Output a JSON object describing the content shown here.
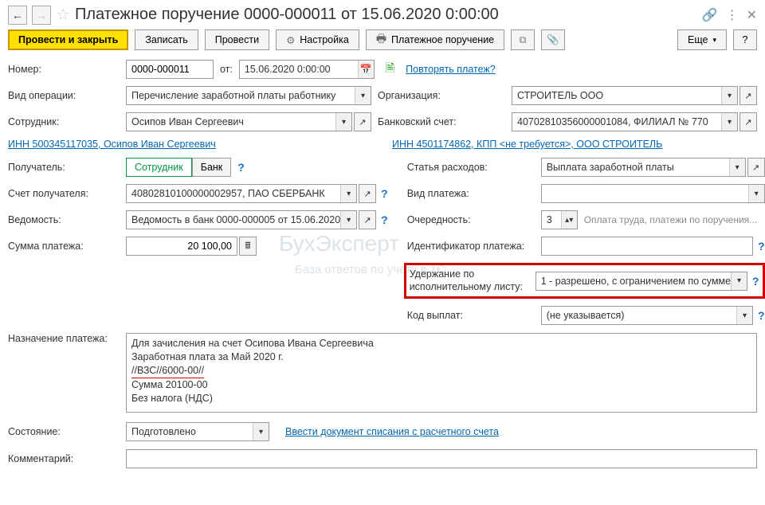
{
  "title": "Платежное поручение 0000-000011 от 15.06.2020 0:00:00",
  "toolbar": {
    "post_close": "Провести и закрыть",
    "save": "Записать",
    "post": "Провести",
    "settings": "Настройка",
    "print_doc": "Платежное поручение",
    "more": "Еще",
    "help": "?"
  },
  "fields": {
    "number_label": "Номер:",
    "number": "0000-000011",
    "from_label": "от:",
    "date": "15.06.2020  0:00:00",
    "repeat_link": "Повторять платеж?",
    "op_type_label": "Вид операции:",
    "op_type": "Перечисление заработной платы работнику",
    "org_label": "Организация:",
    "org": "СТРОИТЕЛЬ ООО",
    "employee_label": "Сотрудник:",
    "employee": "Осипов Иван Сергеевич",
    "bank_acc_label": "Банковский счет:",
    "bank_acc": "40702810356000001084, ФИЛИАЛ № 770",
    "inn_left": "ИНН 500345117035, Осипов Иван Сергеевич",
    "inn_right": "ИНН 4501174862, КПП <не требуется>, ООО СТРОИТЕЛЬ",
    "recipient_label": "Получатель:",
    "seg_employee": "Сотрудник",
    "seg_bank": "Банк",
    "expense_label": "Статья расходов:",
    "expense": "Выплата заработной платы",
    "recip_acc_label": "Счет получателя:",
    "recip_acc": "40802810100000002957, ПАО СБЕРБАНК",
    "pay_type_label": "Вид платежа:",
    "pay_type": "",
    "sheet_label": "Ведомость:",
    "sheet": "Ведомость в банк 0000-000005 от 15.06.2020",
    "order_label": "Очередность:",
    "order": "3",
    "order_hint": "Оплата труда, платежи по поручения...",
    "amount_label": "Сумма платежа:",
    "amount": "20 100,00",
    "ident_label": "Идентификатор платежа:",
    "ident": "",
    "withhold_label": "Удержание по исполнительному листу:",
    "withhold": "1 - разрешено, с ограничением по сумме",
    "paycode_label": "Код выплат:",
    "paycode": "(не указывается)",
    "purpose_label": "Назначение платежа:",
    "purpose_line1": "Для зачисления на счет Осипова Ивана Сергеевича",
    "purpose_line2": "Заработная плата за Май 2020 г.",
    "purpose_line3": "//ВЗС//6000-00//",
    "purpose_line4": "Сумма 20100-00",
    "purpose_line5": "Без налога (НДС)",
    "state_label": "Состояние:",
    "state": "Подготовлено",
    "state_link": "Ввести документ списания с расчетного счета",
    "comment_label": "Комментарий:",
    "comment": ""
  }
}
